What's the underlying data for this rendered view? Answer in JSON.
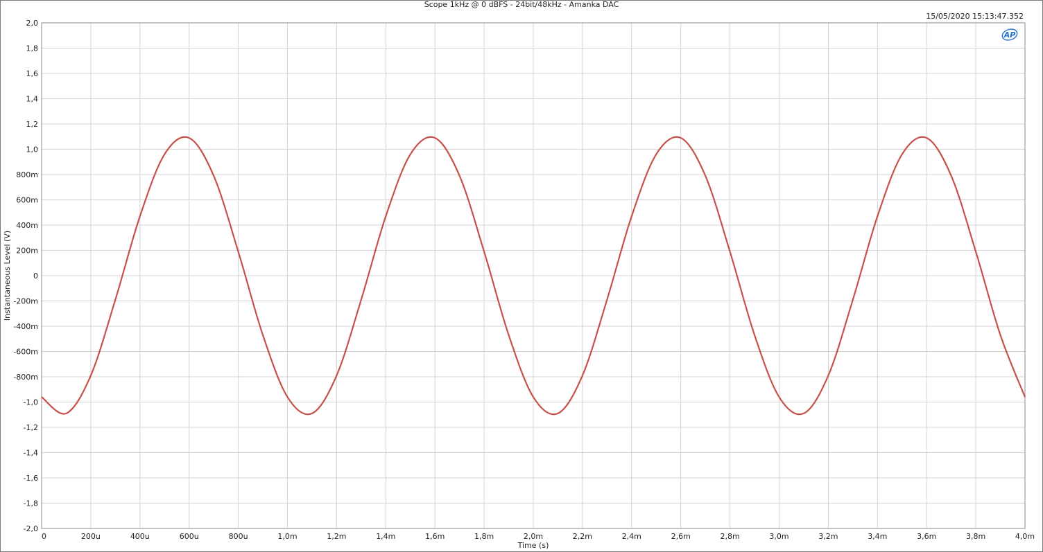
{
  "chart_data": {
    "type": "line",
    "title": "Scope 1kHz @ 0 dBFS - 24bit/48kHz - Amanka DAC",
    "timestamp": "15/05/2020 15:13:47.352",
    "xlabel": "Time (s)",
    "ylabel": "Instantaneous Level (V)",
    "xlim": [
      0,
      0.004
    ],
    "ylim": [
      -2.0,
      2.0
    ],
    "grid": true,
    "x_ticks": [
      0,
      0.0002,
      0.0004,
      0.0006,
      0.0008,
      0.001,
      0.0012,
      0.0014,
      0.0016,
      0.0018,
      0.002,
      0.0022,
      0.0024,
      0.0026,
      0.0028,
      0.003,
      0.0032,
      0.0034,
      0.0036,
      0.0038,
      0.004
    ],
    "x_tick_labels": [
      "0",
      "200u",
      "400u",
      "600u",
      "800u",
      "1,0m",
      "1,2m",
      "1,4m",
      "1,6m",
      "1,8m",
      "2,0m",
      "2,2m",
      "2,4m",
      "2,6m",
      "2,8m",
      "3,0m",
      "3,2m",
      "3,4m",
      "3,6m",
      "3,8m",
      "4,0m"
    ],
    "y_ticks": [
      2.0,
      1.8,
      1.6,
      1.4,
      1.2,
      1.0,
      0.8,
      0.6,
      0.4,
      0.2,
      0,
      -0.2,
      -0.4,
      -0.6,
      -0.8,
      -1.0,
      -1.2,
      -1.4,
      -1.6,
      -1.8,
      -2.0
    ],
    "y_tick_labels": [
      "2,0",
      "1,8",
      "1,6",
      "1,4",
      "1,2",
      "1,0",
      "800m",
      "600m",
      "400m",
      "200m",
      "0",
      "-200m",
      "-400m",
      "-600m",
      "-800m",
      "-1,0",
      "-1,2",
      "-1,4",
      "-1,6",
      "-1,8",
      "-2,0"
    ],
    "series": [
      {
        "color": "#c8504a",
        "x": [
          0,
          0.0001,
          0.0002,
          0.0003,
          0.0004,
          0.0005,
          0.0006,
          0.0007,
          0.0008,
          0.0009,
          0.001,
          0.0011,
          0.0012,
          0.0013,
          0.0014,
          0.0015,
          0.0016,
          0.0017,
          0.0018,
          0.0019,
          0.002,
          0.0021,
          0.0022,
          0.0023,
          0.0024,
          0.0025,
          0.0026,
          0.0027,
          0.0028,
          0.0029,
          0.003,
          0.0031,
          0.0032,
          0.0033,
          0.0034,
          0.0035,
          0.0036,
          0.0037,
          0.0038,
          0.0039,
          0.004
        ],
        "y": [
          -0.96,
          -1.09,
          -0.79,
          -0.19,
          0.47,
          0.96,
          1.09,
          0.79,
          0.19,
          -0.47,
          -0.96,
          -1.09,
          -0.79,
          -0.19,
          0.47,
          0.96,
          1.09,
          0.79,
          0.19,
          -0.47,
          -0.96,
          -1.09,
          -0.79,
          -0.19,
          0.47,
          0.96,
          1.09,
          0.79,
          0.19,
          -0.47,
          -0.96,
          -1.09,
          -0.79,
          -0.19,
          0.47,
          0.96,
          1.09,
          0.79,
          0.19,
          -0.47,
          -0.96
        ]
      }
    ]
  },
  "logo": {
    "text": "AP",
    "color": "#1f6fd1"
  }
}
